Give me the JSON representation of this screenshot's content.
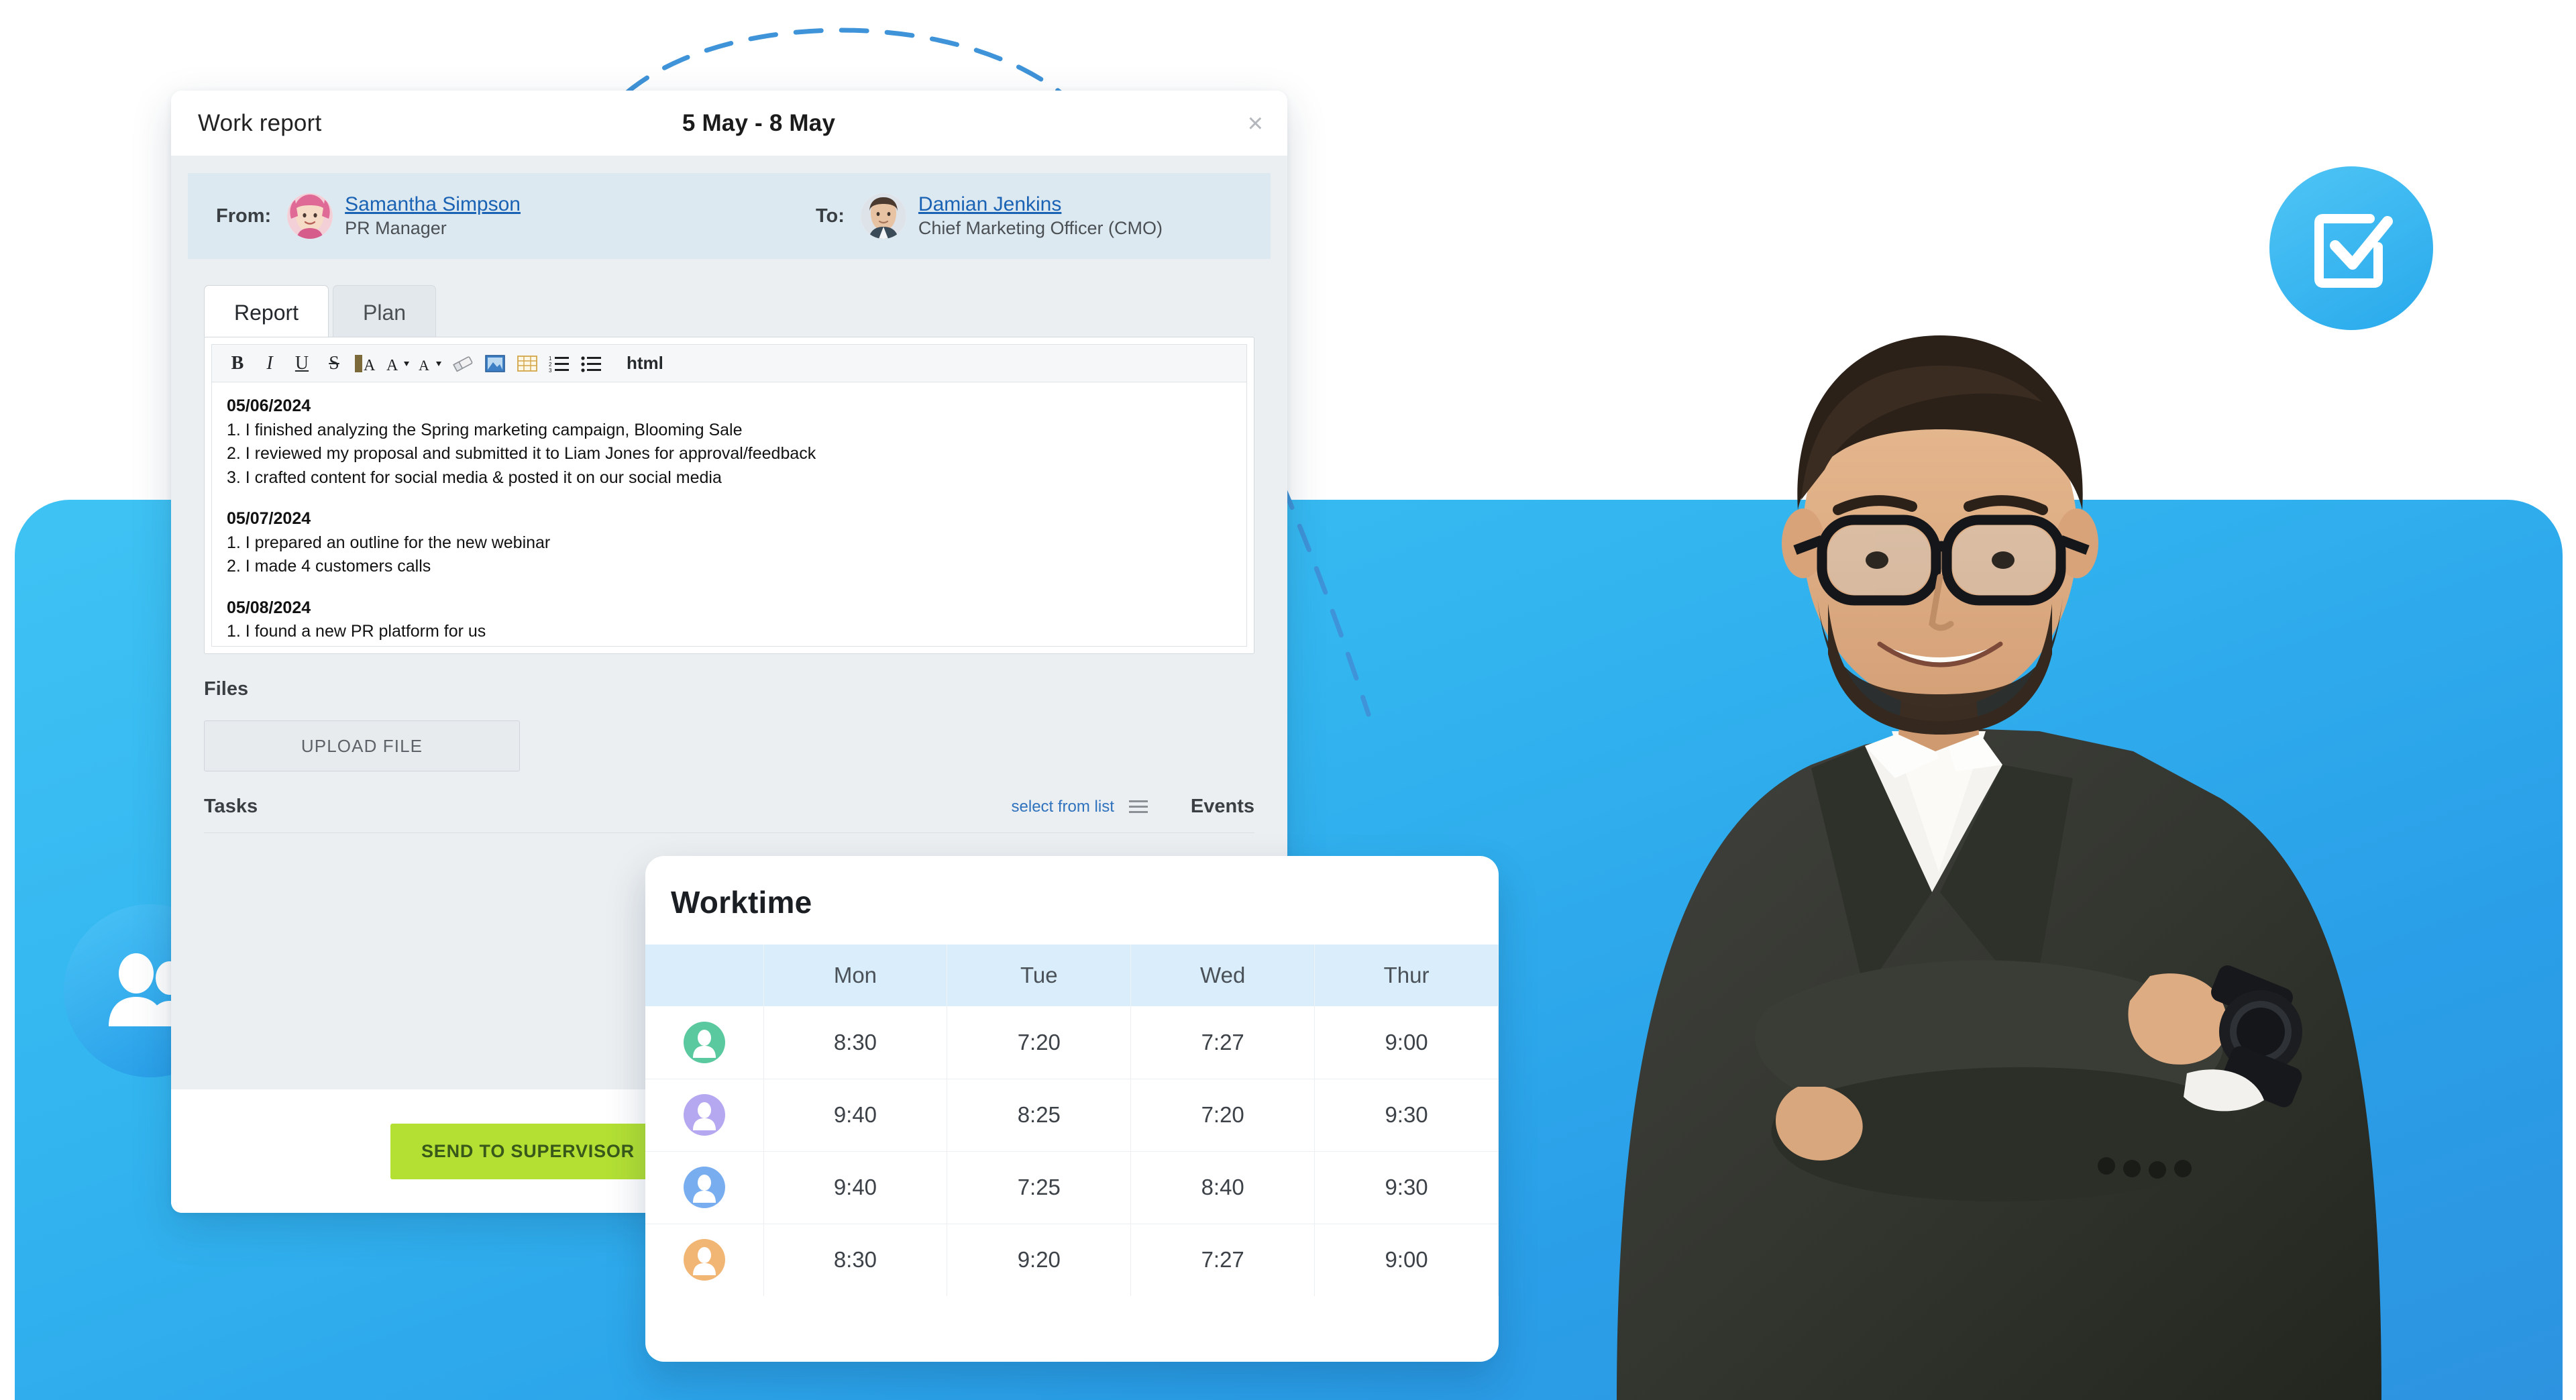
{
  "dialog": {
    "title": "Work report",
    "date_range": "5 May - 8 May",
    "close_icon": "close-icon",
    "from_label": "From:",
    "to_label": "To:",
    "from_person": {
      "name": "Samantha Simpson",
      "role": "PR Manager"
    },
    "to_person": {
      "name": "Damian Jenkins",
      "role": "Chief Marketing Officer (CMO)"
    },
    "tabs": [
      {
        "label": "Report",
        "active": true
      },
      {
        "label": "Plan",
        "active": false
      }
    ],
    "toolbar": [
      {
        "name": "bold-icon",
        "glyph": "B"
      },
      {
        "name": "italic-icon",
        "glyph": "I"
      },
      {
        "name": "underline-icon",
        "glyph": "U"
      },
      {
        "name": "strikethrough-icon",
        "glyph": "S"
      },
      {
        "name": "font-family-icon",
        "glyph": "A"
      },
      {
        "name": "font-size-icon",
        "glyph": "A"
      },
      {
        "name": "text-color-icon",
        "glyph": "A"
      },
      {
        "name": "eraser-icon",
        "glyph": "⌧"
      },
      {
        "name": "image-icon",
        "glyph": "▣"
      },
      {
        "name": "table-icon",
        "glyph": "▦"
      },
      {
        "name": "ordered-list-icon",
        "glyph": "≡"
      },
      {
        "name": "unordered-list-icon",
        "glyph": "≡"
      },
      {
        "name": "html-button",
        "glyph": "html"
      }
    ],
    "report_lines": [
      {
        "text": "05/06/2024",
        "type": "date"
      },
      {
        "text": "1. I finished analyzing the Spring marketing campaign, Blooming Sale",
        "type": "item"
      },
      {
        "text": "2. I reviewed my proposal and submitted it to Liam Jones for approval/feedback",
        "type": "item"
      },
      {
        "text": "3. I crafted content for social media & posted it on our social media",
        "type": "item"
      },
      {
        "text": "",
        "type": "blank"
      },
      {
        "text": "05/07/2024",
        "type": "date"
      },
      {
        "text": "1. I prepared an outline for the new webinar",
        "type": "item"
      },
      {
        "text": "2. I made 4 customers calls",
        "type": "item"
      },
      {
        "text": "",
        "type": "blank"
      },
      {
        "text": "05/08/2024",
        "type": "date"
      },
      {
        "text": "1. I found a new PR platform for us",
        "type": "item"
      }
    ],
    "files_label": "Files",
    "upload_button": "UPLOAD FILE",
    "tasks_label": "Tasks",
    "select_from_list": "select from list",
    "events_label": "Events",
    "send_button": "SEND TO SUPERVISOR"
  },
  "worktime": {
    "title": "Worktime",
    "columns": [
      "",
      "Mon",
      "Tue",
      "Wed",
      "Thur"
    ],
    "rows": [
      {
        "avatar_color": "#5bc9a0",
        "times": [
          "8:30",
          "7:20",
          "7:27",
          "9:00"
        ]
      },
      {
        "avatar_color": "#b6a8f0",
        "times": [
          "9:40",
          "8:25",
          "7:20",
          "9:30"
        ]
      },
      {
        "avatar_color": "#78aef0",
        "times": [
          "9:40",
          "7:25",
          "8:40",
          "9:30"
        ]
      },
      {
        "avatar_color": "#f2b674",
        "times": [
          "8:30",
          "9:20",
          "7:27",
          "9:00"
        ]
      }
    ]
  },
  "decor": {
    "check_badge_icon": "checkbox-check-icon",
    "people_badge_icon": "people-icon"
  },
  "colors": {
    "panel_blue": "#32b4ef",
    "accent_green": "#b3e033",
    "link_blue": "#1a62b3",
    "table_header": "#d9eefa"
  }
}
